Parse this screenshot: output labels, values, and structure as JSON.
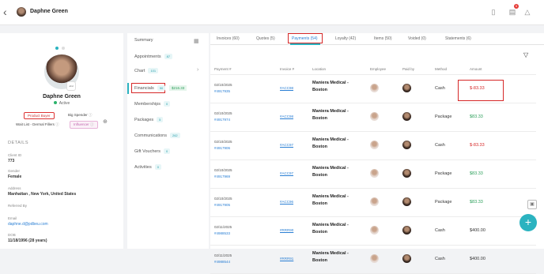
{
  "topbar": {
    "client_name": "Daphne Green",
    "notification_count": "5"
  },
  "profile": {
    "photo_tag": "ahd",
    "name": "Daphne Green",
    "status": "Active",
    "tags": [
      "Product Buyer",
      "Big Spender",
      "Wait List - Dermal Fillers",
      "Influencer"
    ]
  },
  "details": {
    "heading": "DETAILS",
    "fields": [
      {
        "label": "Client ID",
        "value": "773"
      },
      {
        "label": "Gender",
        "value": "Female"
      },
      {
        "label": "Address",
        "value": "Manhattan , New York, United States"
      },
      {
        "label": "Referred By",
        "value": ""
      },
      {
        "label": "Email",
        "value": "daphne.d@pdbeu.com"
      },
      {
        "label": "DOB",
        "value": "11/18/1996 (28 years)"
      }
    ]
  },
  "nav": {
    "items": [
      {
        "label": "Summary",
        "count": ""
      },
      {
        "label": "Appointments",
        "count": "87"
      },
      {
        "label": "Chart",
        "count": "101"
      },
      {
        "label": "Financials",
        "count": "90"
      },
      {
        "label": "Memberships",
        "count": "0"
      },
      {
        "label": "Packages",
        "count": "5"
      },
      {
        "label": "Communications",
        "count": "262"
      },
      {
        "label": "Gift Vouchers",
        "count": "0"
      },
      {
        "label": "Activities",
        "count": "0"
      }
    ],
    "financials_amount": "$216.33"
  },
  "tabs": [
    {
      "label": "Invoices (60)"
    },
    {
      "label": "Quotes (5)"
    },
    {
      "label": "Payments (54)"
    },
    {
      "label": "Loyalty (42)"
    },
    {
      "label": "Items (50)"
    },
    {
      "label": "Voided (0)"
    },
    {
      "label": "Statements (6)"
    }
  ],
  "table": {
    "headers": [
      "Payment #",
      "Invoice #",
      "Location",
      "Employee",
      "Paid by",
      "Method",
      "Amount"
    ],
    "rows": [
      {
        "date": "02/10/2025",
        "payment": "#4917935",
        "invoice": "#ACC98",
        "location": "Maniera Medical - Boston",
        "method": "Cash",
        "amount": "$-83.33",
        "amount_type": "neg"
      },
      {
        "date": "02/10/2025",
        "payment": "#4917974",
        "invoice": "#ACC98",
        "location": "Maniera Medical - Boston",
        "method": "Package",
        "amount": "$83.33",
        "amount_type": "pos"
      },
      {
        "date": "02/10/2025",
        "payment": "#4917906",
        "invoice": "#ACC97",
        "location": "Maniera Medical - Boston",
        "method": "Cash",
        "amount": "$-83.33",
        "amount_type": "neg"
      },
      {
        "date": "02/10/2025",
        "payment": "#4917969",
        "invoice": "#ACC97",
        "location": "Maniera Medical - Boston",
        "method": "Package",
        "amount": "$83.33",
        "amount_type": "pos"
      },
      {
        "date": "02/10/2025",
        "payment": "#4917905",
        "invoice": "#ACC96",
        "location": "Maniera Medical - Boston",
        "method": "Package",
        "amount": "$83.33",
        "amount_type": "pos"
      },
      {
        "date": "02/11/2025",
        "payment": "#4988533",
        "invoice": "#RRR90",
        "location": "Maniera Medical - Boston",
        "method": "Cash",
        "amount": "$400.00",
        "amount_type": "neu"
      },
      {
        "date": "02/11/2025",
        "payment": "#4988544",
        "invoice": "#RRR91",
        "location": "Maniera Medical - Boston",
        "method": "Cash",
        "amount": "$400.00",
        "amount_type": "neu"
      }
    ]
  }
}
